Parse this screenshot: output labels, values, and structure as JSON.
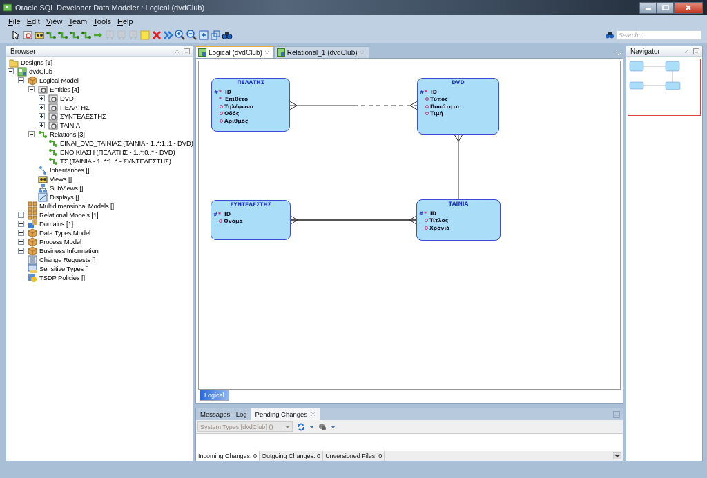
{
  "window": {
    "title": "Oracle SQL Developer Data Modeler : Logical (dvdClub)"
  },
  "menu": [
    {
      "label": "File"
    },
    {
      "label": "Edit"
    },
    {
      "label": "View"
    },
    {
      "label": "Team"
    },
    {
      "label": "Tools"
    },
    {
      "label": "Help"
    }
  ],
  "toolbar": [
    {
      "kind": "pointer",
      "disabled": false
    },
    {
      "kind": "entity",
      "disabled": false
    },
    {
      "kind": "view",
      "disabled": false
    },
    {
      "kind": "relation",
      "disabled": false
    },
    {
      "kind": "relation",
      "disabled": false
    },
    {
      "kind": "relation",
      "disabled": false
    },
    {
      "kind": "relation",
      "disabled": false
    },
    {
      "kind": "arrow",
      "disabled": false
    },
    {
      "kind": "table",
      "disabled": true
    },
    {
      "kind": "table",
      "disabled": true
    },
    {
      "kind": "table",
      "disabled": true
    },
    {
      "kind": "note",
      "disabled": false
    },
    {
      "kind": "delete",
      "disabled": false
    },
    {
      "kind": "chevron",
      "disabled": false
    },
    {
      "kind": "zoom-in",
      "disabled": false
    },
    {
      "kind": "zoom-out",
      "disabled": false
    },
    {
      "kind": "fit",
      "disabled": false
    },
    {
      "kind": "layout",
      "disabled": false
    },
    {
      "kind": "find",
      "disabled": false
    }
  ],
  "search": {
    "placeholder": "Search..."
  },
  "browser": {
    "title": "Browser",
    "tree": [
      {
        "label": "Designs [1]",
        "kind": "folder"
      },
      {
        "label": "dvdClub",
        "kind": "design",
        "expanded": true,
        "children": [
          {
            "label": "Logical Model",
            "kind": "model",
            "expanded": true,
            "children": [
              {
                "label": "Entities [4]",
                "kind": "entity",
                "expanded": true,
                "children": [
                  {
                    "label": "DVD",
                    "kind": "entity",
                    "expanded": false
                  },
                  {
                    "label": "ΠΕΛΑΤΗΣ",
                    "kind": "entity",
                    "expanded": false
                  },
                  {
                    "label": "ΣΥΝΤΕΛΕΣΤΗΣ",
                    "kind": "entity",
                    "expanded": false
                  },
                  {
                    "label": "ΤΑΙΝΙΑ",
                    "kind": "entity",
                    "expanded": false
                  }
                ]
              },
              {
                "label": "Relations [3]",
                "kind": "relation",
                "expanded": true,
                "children": [
                  {
                    "label": "ΕΙΝΑΙ_DVD_ΤΑΙΝΙΑΣ (ΤΑΙΝΙΑ - 1..*:1..1 - DVD)",
                    "kind": "relation"
                  },
                  {
                    "label": "ΕΝΟΙΚΙΑΣΗ (ΠΕΛΑΤΗΣ - 1..*:0..* - DVD)",
                    "kind": "relation"
                  },
                  {
                    "label": "ΤΣ (ΤΑΙΝΙΑ - 1..*:1..* - ΣΥΝΤΕΛΕΣΤΗΣ)",
                    "kind": "relation"
                  }
                ]
              },
              {
                "label": "Inheritances []",
                "kind": "inheritance"
              },
              {
                "label": "Views []",
                "kind": "view"
              },
              {
                "label": "SubViews []",
                "kind": "subview"
              },
              {
                "label": "Displays []",
                "kind": "display"
              }
            ]
          },
          {
            "label": "Multidimensional Models []",
            "kind": "grid"
          },
          {
            "label": "Relational Models [1]",
            "kind": "grid",
            "expanded": false
          },
          {
            "label": "Domains [1]",
            "kind": "domain",
            "expanded": false
          },
          {
            "label": "Data Types Model",
            "kind": "model",
            "expanded": false
          },
          {
            "label": "Process Model",
            "kind": "model",
            "expanded": false
          },
          {
            "label": "Business Information",
            "kind": "model",
            "expanded": false
          },
          {
            "label": "Change Requests []",
            "kind": "list"
          },
          {
            "label": "Sensitive Types []",
            "kind": "sensitive"
          },
          {
            "label": "TSDP Policies []",
            "kind": "policy"
          }
        ]
      }
    ]
  },
  "editor": {
    "tabs": [
      {
        "label": "Logical (dvdClub)",
        "selected": true
      },
      {
        "label": "Relational_1 (dvdClub)",
        "selected": false
      }
    ],
    "entities": [
      {
        "name": "ΠΕΛΑΤΗΣ",
        "attributes": [
          {
            "pk_mark": "#",
            "req_mark": "*",
            "name": "ID"
          },
          {
            "req_mark": "*",
            "name": "Επίθετο"
          },
          {
            "optional": true,
            "name": "Τηλέφωνο"
          },
          {
            "optional": true,
            "name": "Οδός"
          },
          {
            "optional": true,
            "name": "Αριθμός"
          }
        ]
      },
      {
        "name": "DVD",
        "attributes": [
          {
            "pk_mark": "#",
            "req_mark": "*",
            "name": "ID"
          },
          {
            "optional": true,
            "name": "Τύπος"
          },
          {
            "optional": true,
            "name": "Ποσότητα"
          },
          {
            "optional": true,
            "name": "Τιμή"
          }
        ]
      },
      {
        "name": "ΣΥΝΤΕΛΕΣΤΗΣ",
        "attributes": [
          {
            "pk_mark": "#",
            "req_mark": "*",
            "name": "ID"
          },
          {
            "optional": true,
            "name": "Όνομα"
          }
        ]
      },
      {
        "name": "ΤΑΙΝΙΑ",
        "attributes": [
          {
            "pk_mark": "#",
            "req_mark": "*",
            "name": "ID"
          },
          {
            "optional": true,
            "name": "Τίτλος"
          },
          {
            "optional": true,
            "name": "Χρονιά"
          }
        ]
      }
    ],
    "subtabs": [
      {
        "label": "Logical",
        "selected": true
      }
    ]
  },
  "bottom_panel": {
    "tabs": [
      {
        "label": "Messages - Log",
        "selected": false
      },
      {
        "label": "Pending Changes",
        "selected": true
      }
    ],
    "filter": {
      "value": "System Types [dvdClub] ()",
      "disabled": true
    },
    "status": [
      "Incoming Changes: 0",
      "Outgoing Changes: 0",
      "Unversioned Files: 0"
    ]
  },
  "navigator": {
    "title": "Navigator"
  }
}
